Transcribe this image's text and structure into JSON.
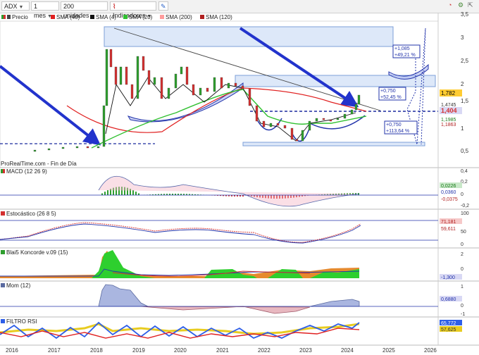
{
  "toolbar": {
    "symbol": "ADX",
    "period": "1 mes",
    "units": "200 unidades",
    "indicators": "Indicadores"
  },
  "legend": {
    "price": "Precio",
    "sma40": "SMA (40)",
    "sma4": "SMA (4)",
    "sma20": "SMA (20)",
    "sma200": "SMA (200)",
    "sma120": "SMA (120)"
  },
  "source": "ProRealTime.com - Fin de Día",
  "panels": {
    "macd": "MACD (12 26 9)",
    "stoch": "Estocástico (26 8 5)",
    "koncorde": "Blai5 Koncorde v.09 (15)",
    "mom": "Mom (12)",
    "rsi": "FILTRO RSI"
  },
  "annotations": {
    "a1_line1": "+1,085",
    "a1_line2": "+49,21 %",
    "a2_line1": "+0,750",
    "a2_line2": "+52,45 %",
    "a3_line1": "+0,750",
    "a3_line2": "+113,64 %"
  },
  "price_axis": {
    "ticks": [
      "3,5",
      "3",
      "2,5",
      "2",
      "1,5",
      "1",
      "0,5"
    ],
    "last_price": "1,782",
    "level_1": "1,4745",
    "level_2": "1,404",
    "level_3": "1,1985",
    "level_4": "1,1863"
  },
  "macd_axis": {
    "ticks": [
      "0,4",
      "0,2",
      "0",
      "-0,2"
    ],
    "v1": "0,0226",
    "v2": "0,0360",
    "v3": "-0,0375"
  },
  "stoch_axis": {
    "ticks": [
      "100",
      "50",
      "0"
    ],
    "v1": "71,181",
    "v2": "59,611"
  },
  "kon_axis": {
    "ticks": [
      "2",
      "0"
    ],
    "v1": "-1,300"
  },
  "mom_axis": {
    "ticks": [
      "1",
      "0",
      "-1"
    ],
    "v1": "0,6880"
  },
  "rsi_axis": {
    "v1": "65,772",
    "v2": "57,625"
  },
  "x_axis": [
    "2016",
    "2017",
    "2018",
    "2019",
    "2020",
    "2021",
    "2022",
    "2023",
    "2024",
    "2025",
    "2026"
  ],
  "colors": {
    "up": "#2e9e2e",
    "down": "#d43030",
    "blue_arrow": "#2233cc",
    "box": "#c6d9f5"
  }
}
